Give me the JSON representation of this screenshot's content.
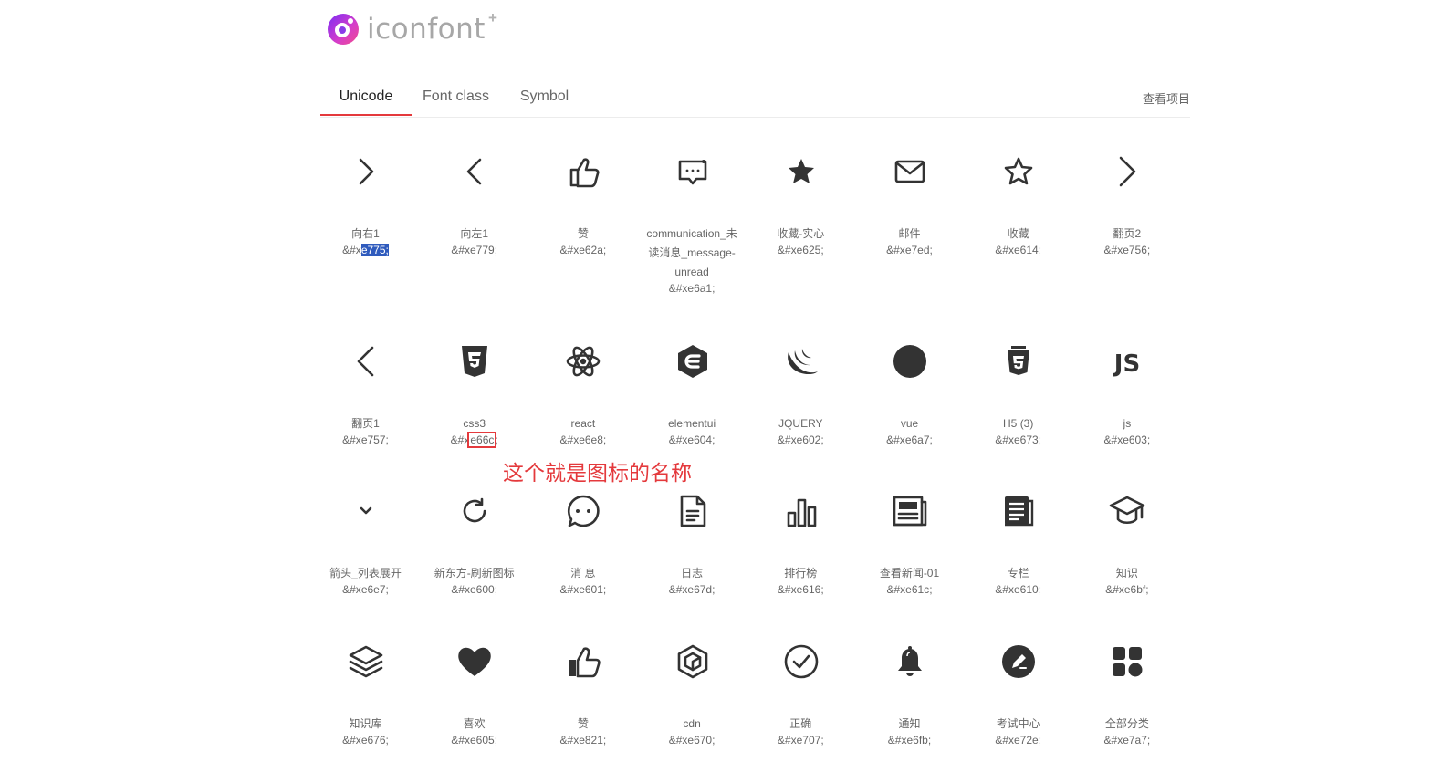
{
  "brand": {
    "name": "iconfont",
    "plus": "+"
  },
  "tabs": [
    {
      "label": "Unicode"
    },
    {
      "label": "Font class"
    },
    {
      "label": "Symbol"
    }
  ],
  "view_project_label": "查看项目",
  "annotation": "这个就是图标的名称",
  "colors": {
    "accent": "#e4393c",
    "selection": "#2f5bbd"
  },
  "icons": [
    {
      "name": "向右1",
      "prefix": "&#x",
      "code": "e775",
      "suffix": ";",
      "icon": "chevron-right-icon",
      "state": "selected"
    },
    {
      "name": "向左1",
      "prefix": "&#x",
      "code": "e779",
      "suffix": ";",
      "icon": "chevron-left-icon"
    },
    {
      "name": "赞",
      "prefix": "&#x",
      "code": "e62a",
      "suffix": ";",
      "icon": "thumbs-up-outline-icon"
    },
    {
      "name_lines": [
        "communication_未",
        "读消息_message-",
        "unread"
      ],
      "prefix": "&#x",
      "code": "e6a1",
      "suffix": ";",
      "icon": "message-unread-icon"
    },
    {
      "name": "收藏-实心",
      "prefix": "&#x",
      "code": "e625",
      "suffix": ";",
      "icon": "star-filled-icon"
    },
    {
      "name": "邮件",
      "prefix": "&#x",
      "code": "e7ed",
      "suffix": ";",
      "icon": "mail-icon"
    },
    {
      "name": "收藏",
      "prefix": "&#x",
      "code": "e614",
      "suffix": ";",
      "icon": "star-outline-icon"
    },
    {
      "name": "翻页2",
      "prefix": "&#x",
      "code": "e756",
      "suffix": ";",
      "icon": "page-next-icon"
    },
    {
      "name": "翻页1",
      "prefix": "&#x",
      "code": "e757",
      "suffix": ";",
      "icon": "page-prev-icon"
    },
    {
      "name": "css3",
      "prefix": "&#x",
      "code": "e66c",
      "suffix": ";",
      "icon": "css3-icon",
      "state": "boxed"
    },
    {
      "name": "react",
      "prefix": "&#x",
      "code": "e6e8",
      "suffix": ";",
      "icon": "react-icon"
    },
    {
      "name": "elementui",
      "prefix": "&#x",
      "code": "e604",
      "suffix": ";",
      "icon": "elementui-icon"
    },
    {
      "name": "JQUERY",
      "prefix": "&#x",
      "code": "e602",
      "suffix": ";",
      "icon": "jquery-icon"
    },
    {
      "name": "vue",
      "prefix": "&#x",
      "code": "e6a7",
      "suffix": ";",
      "icon": "vue-icon"
    },
    {
      "name": "H5 (3)",
      "prefix": "&#x",
      "code": "e673",
      "suffix": ";",
      "icon": "html5-icon"
    },
    {
      "name": "js",
      "prefix": "&#x",
      "code": "e603",
      "suffix": ";",
      "icon": "js-icon"
    },
    {
      "name": "箭头_列表展开",
      "prefix": "&#x",
      "code": "e6e7",
      "suffix": ";",
      "icon": "chevron-down-icon"
    },
    {
      "name": "新东方-刷新图标",
      "prefix": "&#x",
      "code": "e600",
      "suffix": ";",
      "icon": "refresh-icon"
    },
    {
      "name": "消 息",
      "prefix": "&#x",
      "code": "e601",
      "suffix": ";",
      "icon": "chat-bubble-icon"
    },
    {
      "name": "日志",
      "prefix": "&#x",
      "code": "e67d",
      "suffix": ";",
      "icon": "document-icon"
    },
    {
      "name": "排行榜",
      "prefix": "&#x",
      "code": "e616",
      "suffix": ";",
      "icon": "bar-chart-icon"
    },
    {
      "name": "查看新闻-01",
      "prefix": "&#x",
      "code": "e61c",
      "suffix": ";",
      "icon": "news-icon"
    },
    {
      "name": "专栏",
      "prefix": "&#x",
      "code": "e610",
      "suffix": ";",
      "icon": "column-icon"
    },
    {
      "name": "知识",
      "prefix": "&#x",
      "code": "e6bf",
      "suffix": ";",
      "icon": "graduation-cap-icon"
    },
    {
      "name": "知识库",
      "prefix": "&#x",
      "code": "e676",
      "suffix": ";",
      "icon": "layers-icon"
    },
    {
      "name": "喜欢",
      "prefix": "&#x",
      "code": "e605",
      "suffix": ";",
      "icon": "heart-icon"
    },
    {
      "name": "赞",
      "prefix": "&#x",
      "code": "e821",
      "suffix": ";",
      "icon": "thumbs-up-icon"
    },
    {
      "name": "cdn",
      "prefix": "&#x",
      "code": "e670",
      "suffix": ";",
      "icon": "cdn-icon"
    },
    {
      "name": "正确",
      "prefix": "&#x",
      "code": "e707",
      "suffix": ";",
      "icon": "check-circle-icon"
    },
    {
      "name": "通知",
      "prefix": "&#x",
      "code": "e6fb",
      "suffix": ";",
      "icon": "bell-icon"
    },
    {
      "name": "考试中心",
      "prefix": "&#x",
      "code": "e72e",
      "suffix": ";",
      "icon": "exam-edit-icon"
    },
    {
      "name": "全部分类",
      "prefix": "&#x",
      "code": "e7a7",
      "suffix": ";",
      "icon": "grid-categories-icon"
    }
  ]
}
